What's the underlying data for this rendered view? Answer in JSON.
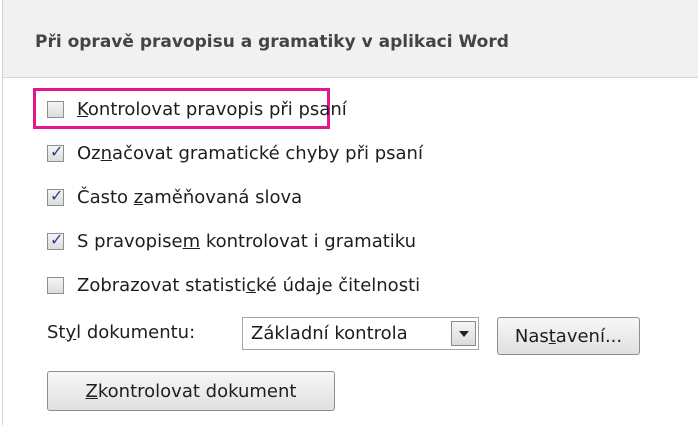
{
  "section": {
    "title": "Při opravě pravopisu a gramatiky v aplikaci Word"
  },
  "options": [
    {
      "pre": "",
      "key": "K",
      "post": "ontrolovat pravopis při psaní",
      "checked": false,
      "highlighted": true
    },
    {
      "pre": "Oz",
      "key": "n",
      "post": "ačovat gramatické chyby při psaní",
      "checked": true,
      "highlighted": false
    },
    {
      "pre": "Často ",
      "key": "z",
      "post": "aměňovaná slova",
      "checked": true,
      "highlighted": false
    },
    {
      "pre": "S pravopise",
      "key": "m",
      "post": " kontrolovat i gramatiku",
      "checked": true,
      "highlighted": false
    },
    {
      "pre": "Zobrazovat statisti",
      "key": "c",
      "post": "ké údaje čitelnosti",
      "checked": false,
      "highlighted": false
    }
  ],
  "check_mark": "✓",
  "document_style": {
    "label_pre": "St",
    "label_key": "y",
    "label_post": "l dokumentu:",
    "selected": "Základní kontrola"
  },
  "buttons": {
    "settings": {
      "pre": "Nas",
      "key": "t",
      "post": "avení..."
    },
    "check_document": {
      "pre": "",
      "key": "Z",
      "post": "kontrolovat dokument"
    }
  },
  "colors": {
    "highlight": "#e3168d",
    "checkmark": "#2a3f8c",
    "header_bg": "#f1f1f1"
  }
}
